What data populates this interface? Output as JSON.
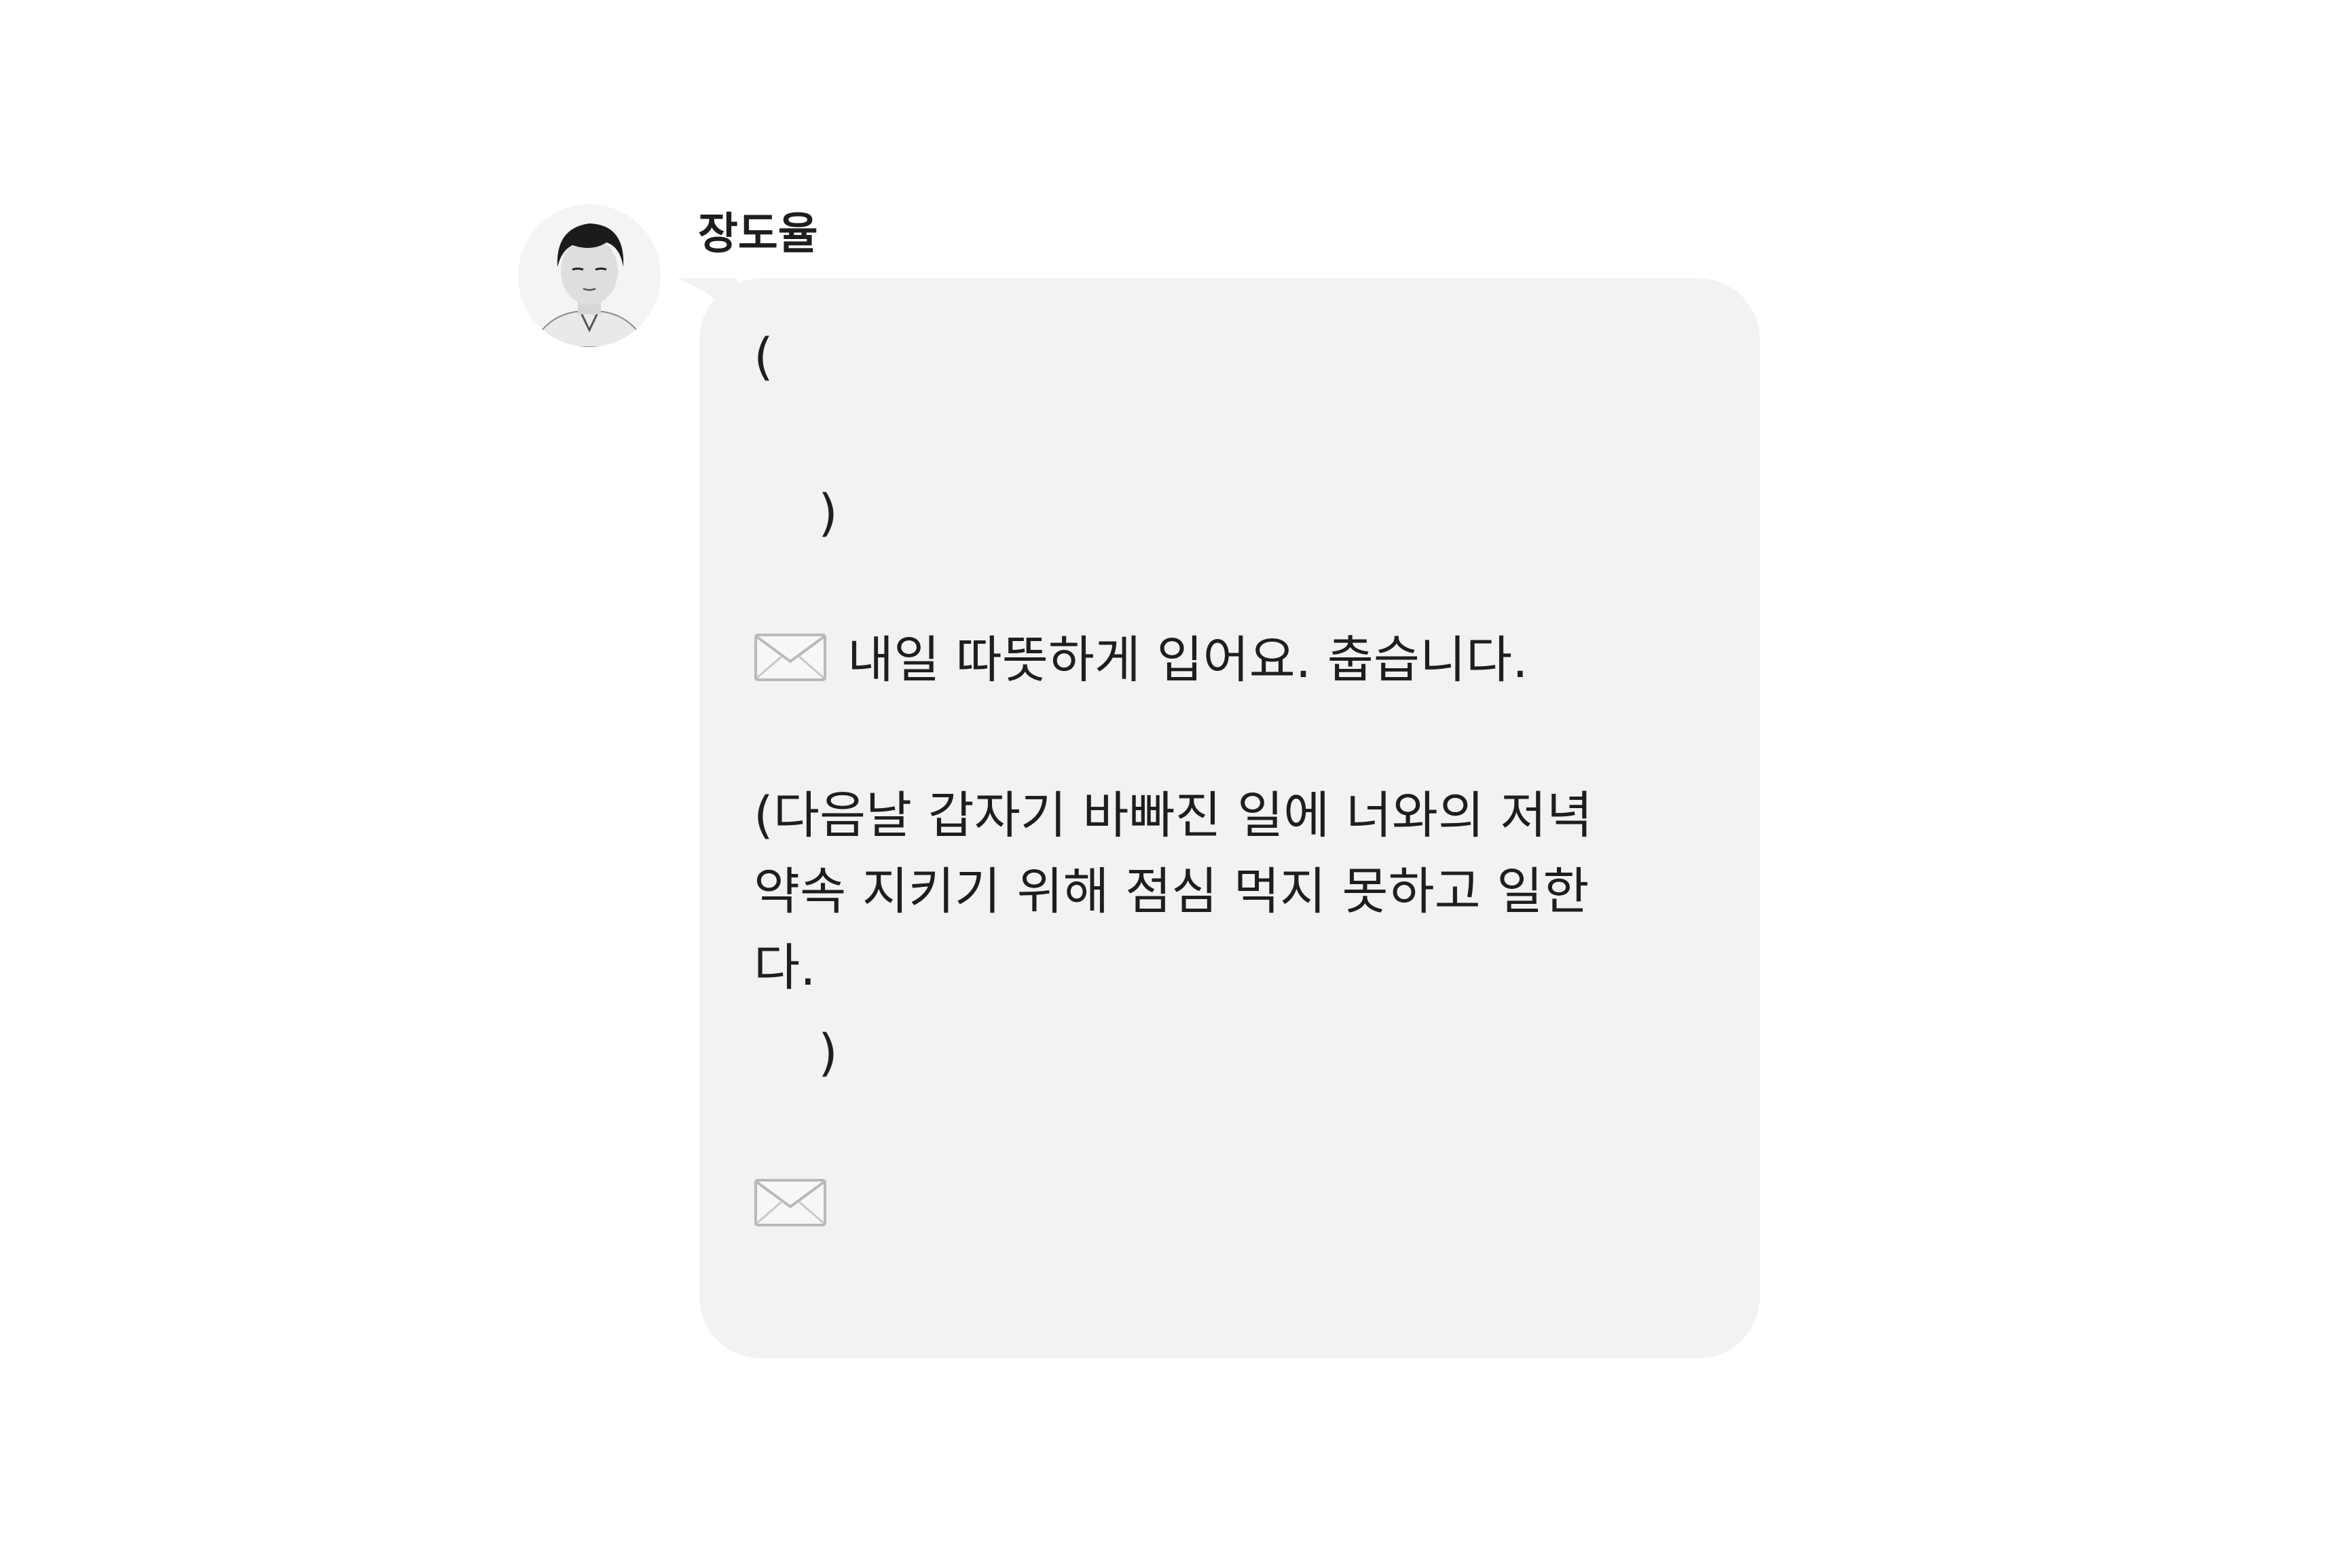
{
  "sender": {
    "name": "장도율"
  },
  "message": {
    "open_paren": "(",
    "close_paren_1": ")",
    "line_1": "내일 따뜻하게 입어요. 춥습니다.",
    "line_2": "(다음날 갑자기 바빠진 일에 너와의 저녁",
    "line_3": "약속 지키기 위해 점심 먹지 못하고 일한",
    "line_4": "다.",
    "close_paren_2": ")"
  },
  "icons": {
    "envelope": "envelope-icon",
    "avatar": "profile-photo"
  },
  "colors": {
    "bubble": "#f1f2f4",
    "text": "#1e1e1e",
    "background": "#ffffff"
  }
}
